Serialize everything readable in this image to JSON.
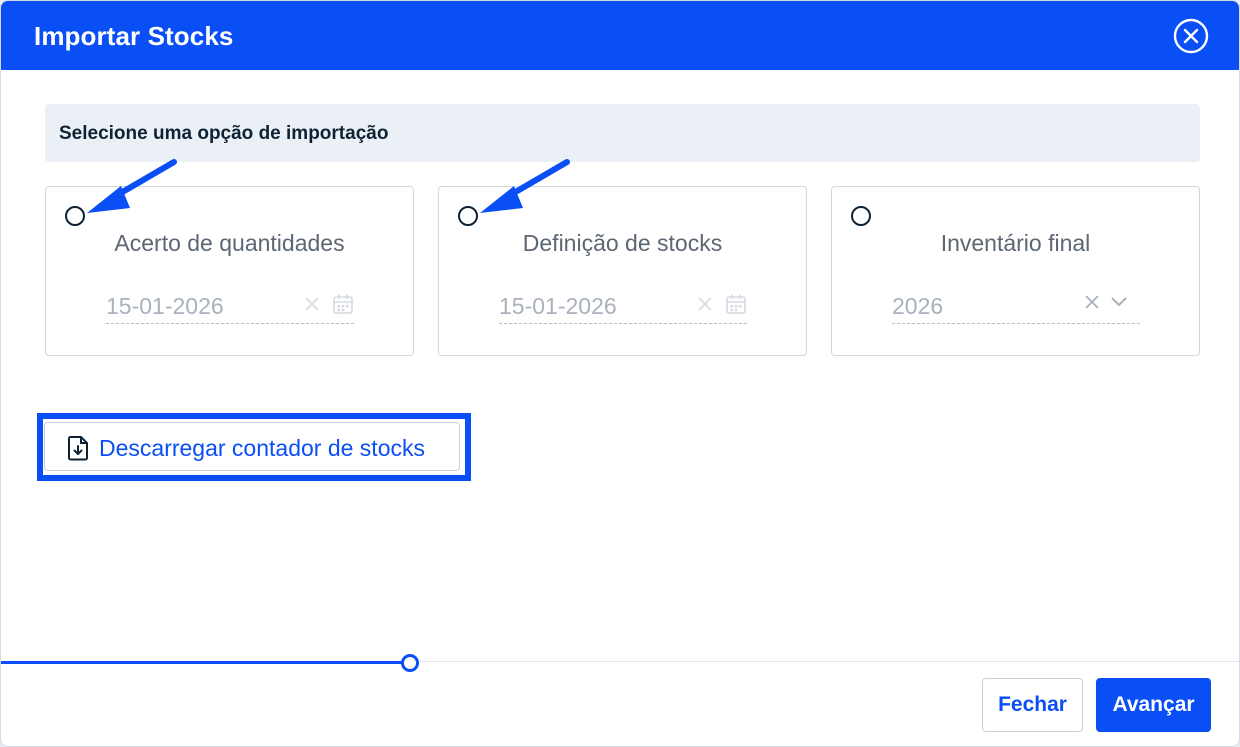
{
  "dialog": {
    "title": "Importar Stocks"
  },
  "section": {
    "heading": "Selecione uma opção de importação"
  },
  "options": [
    {
      "label": "Acerto de quantidades",
      "value": "15-01-2026",
      "selected": false
    },
    {
      "label": "Definição de stocks",
      "value": "15-01-2026",
      "selected": false
    },
    {
      "label": "Inventário final",
      "value": "2026",
      "selected": false
    }
  ],
  "download": {
    "label": "Descarregar contador de stocks"
  },
  "progress": {
    "fraction": 0.33
  },
  "footer": {
    "close_label": "Fechar",
    "next_label": "Avançar"
  },
  "colors": {
    "brand": "#0a4ef5",
    "text_dark": "#0f2233",
    "text_muted": "#5c6773",
    "placeholder": "#a9b1bd"
  },
  "icons": {
    "close": "close-circle-icon",
    "calendar": "calendar-icon",
    "clear": "clear-x-icon",
    "chevron": "chevron-down-icon",
    "download": "file-download-icon"
  }
}
